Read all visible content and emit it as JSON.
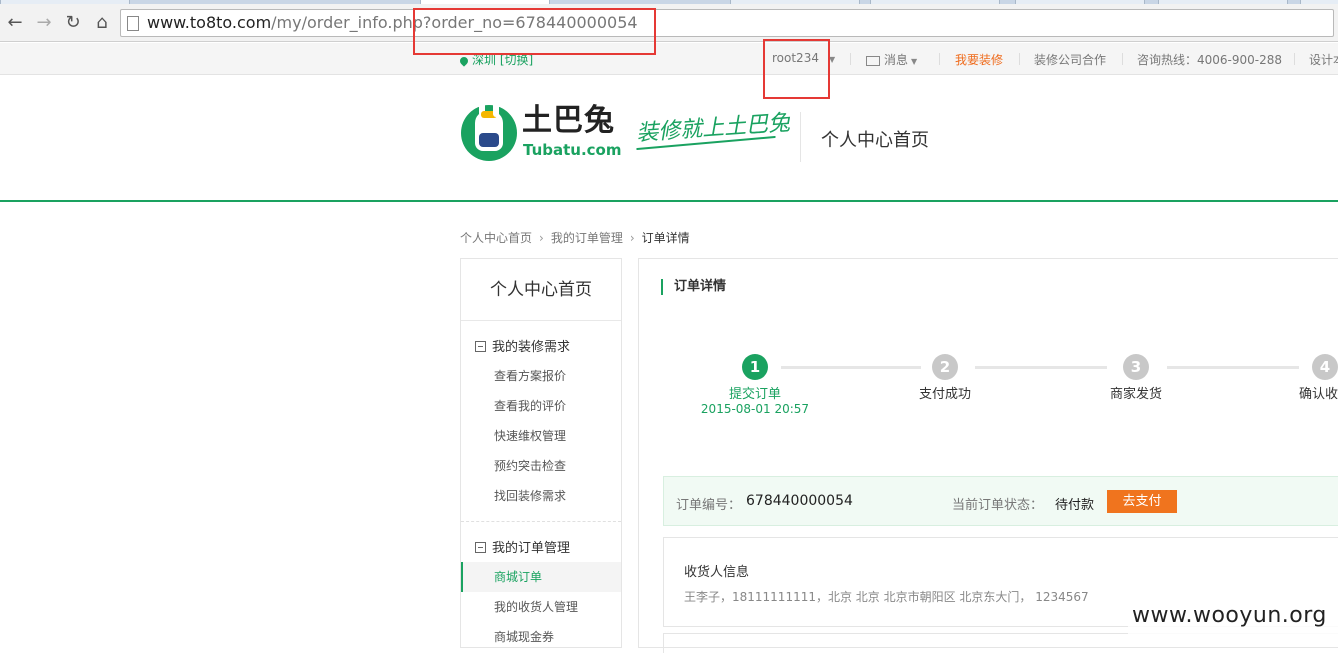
{
  "browser": {
    "url_host": "www.to8to.com",
    "url_path": "/my/order_info.php?order_no=678440000054"
  },
  "topbar": {
    "city": "深圳",
    "switch_label": "[切换]",
    "username": "root234",
    "messages_label": "消息",
    "renovate_label": "我要装修",
    "cooperation_label": "装修公司合作",
    "hotline_label": "咨询热线：4006-900-288",
    "designer_label": "设计本"
  },
  "header": {
    "logo_cn": "土巴兔",
    "logo_en": "Tubatu.com",
    "slogan": "装修就上土巴兔",
    "page_title": "个人中心首页"
  },
  "breadcrumb": [
    "个人中心首页",
    "我的订单管理",
    "订单详情"
  ],
  "sidebar": {
    "title": "个人中心首页",
    "groups": [
      {
        "label": "我的装修需求",
        "items": [
          "查看方案报价",
          "查看我的评价",
          "快速维权管理",
          "预约突击检查",
          "找回装修需求"
        ]
      },
      {
        "label": "我的订单管理",
        "items": [
          "商城订单",
          "我的收货人管理",
          "商城现金券"
        ]
      }
    ],
    "active_item": "商城订单"
  },
  "main": {
    "title": "订单详情",
    "steps": [
      {
        "num": "1",
        "label": "提交订单",
        "time": "2015-08-01 20:57",
        "active": true
      },
      {
        "num": "2",
        "label": "支付成功",
        "time": "",
        "active": false
      },
      {
        "num": "3",
        "label": "商家发货",
        "time": "",
        "active": false
      },
      {
        "num": "4",
        "label": "确认收货",
        "time": "",
        "active": false
      }
    ],
    "order_no_label": "订单编号：",
    "order_no": "678440000054",
    "status_label": "当前订单状态：",
    "status": "待付款",
    "pay_button": "去支付",
    "receiver_title": "收货人信息",
    "receiver_info": "王李子，18111111111，北京 北京 北京市朝阳区 北京东大门， 1234567"
  },
  "watermark": "www.wooyun.org",
  "colors": {
    "brand_green": "#1aa260",
    "accent_orange": "#f0741e",
    "highlight_red": "#e53935"
  }
}
